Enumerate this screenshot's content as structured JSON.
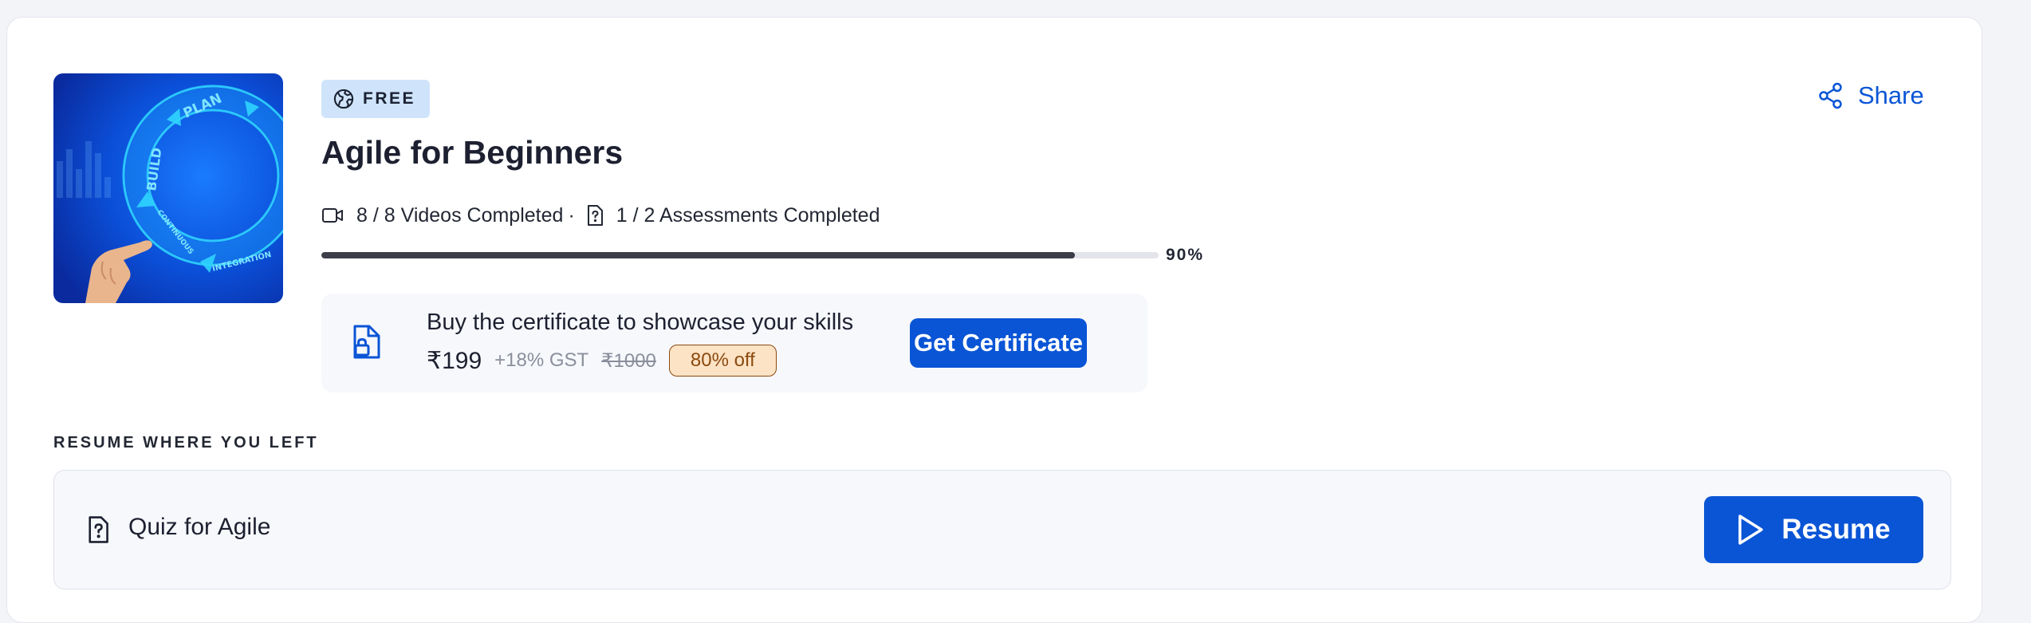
{
  "course": {
    "badge_label": "FREE",
    "title": "Agile for Beginners",
    "videos_completed": "8 / 8 Videos Completed",
    "separator": "·",
    "assessments_completed": "1 / 2 Assessments Completed",
    "progress_percent": 90,
    "progress_label": "90%",
    "thumbnail_words": [
      "PLAN",
      "BUILD",
      "CONTINUOUS",
      "INTEGRATION"
    ]
  },
  "certificate": {
    "heading": "Buy the certificate to showcase your skills",
    "price": "₹199",
    "gst": "+18% GST",
    "original_price": "₹1000",
    "discount": "80% off",
    "button_label": "Get Certificate"
  },
  "header": {
    "share_label": "Share"
  },
  "resume": {
    "section_label": "RESUME WHERE YOU LEFT",
    "item_title": "Quiz for Agile",
    "button_label": "Resume"
  },
  "icons": {
    "badge": "globe-badge-icon",
    "videos": "video-camera-icon",
    "assessments": "quiz-document-icon",
    "certificate": "locked-document-icon",
    "share": "share-icon",
    "resume_item": "quiz-document-icon",
    "resume_button": "play-icon"
  },
  "colors": {
    "accent": "#0a55d6",
    "badge_bg": "#cfe4fb",
    "discount_bg": "#fde3c5",
    "discount_text": "#8a4a10",
    "progress_fill": "#3b3d48"
  }
}
